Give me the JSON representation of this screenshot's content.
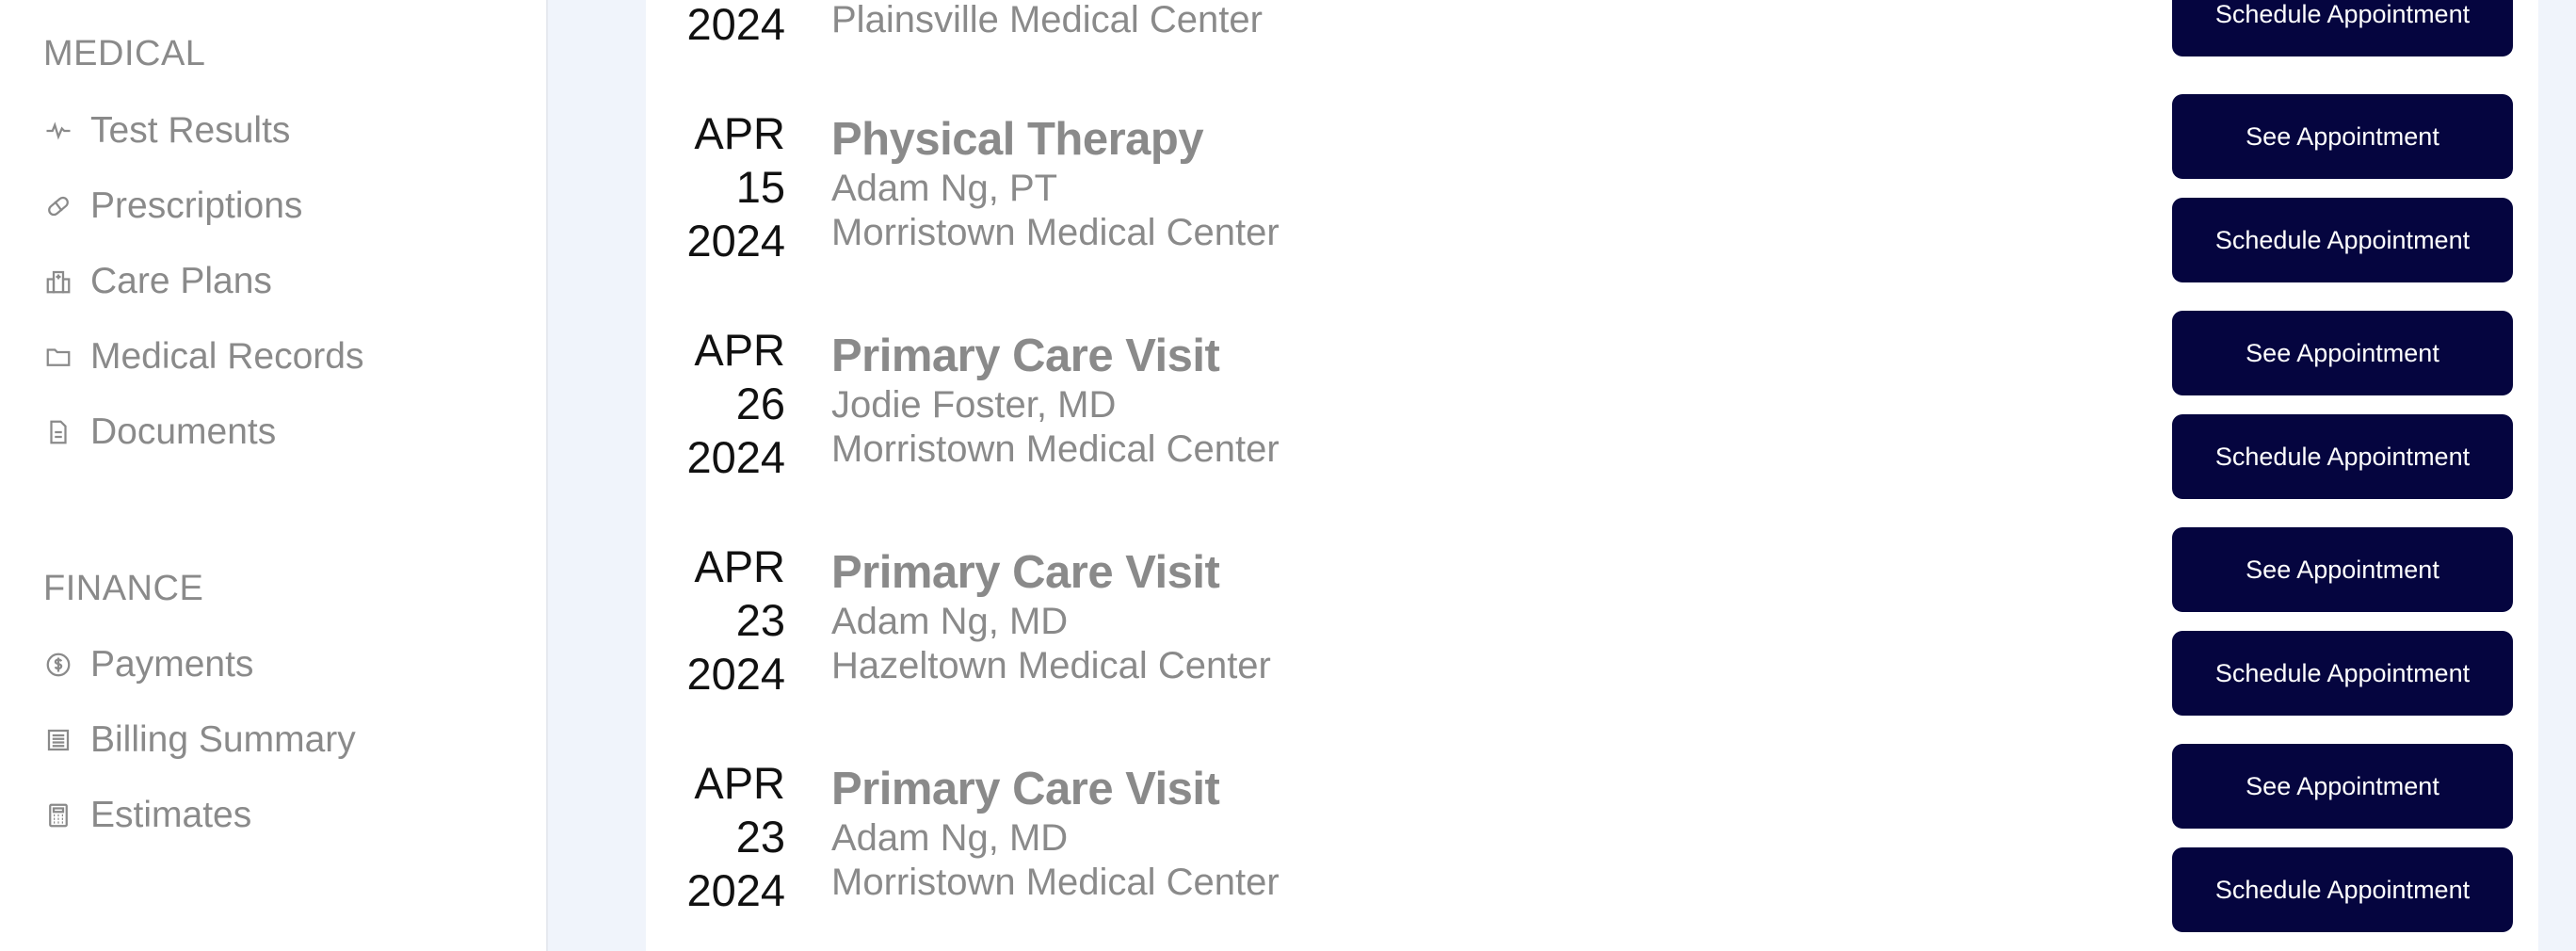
{
  "sidebar": {
    "medical": {
      "title": "MEDICAL",
      "items": [
        {
          "label": "Test Results",
          "icon": "activity-icon"
        },
        {
          "label": "Prescriptions",
          "icon": "pill-icon"
        },
        {
          "label": "Care Plans",
          "icon": "hospital-icon"
        },
        {
          "label": "Medical Records",
          "icon": "folder-icon"
        },
        {
          "label": "Documents",
          "icon": "document-icon"
        }
      ]
    },
    "finance": {
      "title": "FINANCE",
      "items": [
        {
          "label": "Payments",
          "icon": "dollar-icon"
        },
        {
          "label": "Billing Summary",
          "icon": "receipt-icon"
        },
        {
          "label": "Estimates",
          "icon": "calculator-icon"
        }
      ]
    }
  },
  "appointments": [
    {
      "year": "2024",
      "location": "Plainsville Medical Center",
      "schedule_label": "Schedule Appointment"
    },
    {
      "month": "APR",
      "day": "15",
      "year": "2024",
      "title": "Physical Therapy",
      "provider": "Adam Ng, PT",
      "location": "Morristown Medical Center",
      "see_label": "See Appointment",
      "schedule_label": "Schedule Appointment"
    },
    {
      "month": "APR",
      "day": "26",
      "year": "2024",
      "title": "Primary Care Visit",
      "provider": "Jodie Foster, MD",
      "location": "Morristown Medical Center",
      "see_label": "See Appointment",
      "schedule_label": "Schedule Appointment"
    },
    {
      "month": "APR",
      "day": "23",
      "year": "2024",
      "title": "Primary Care Visit",
      "provider": "Adam Ng, MD",
      "location": "Hazeltown Medical Center",
      "see_label": "See Appointment",
      "schedule_label": "Schedule Appointment"
    },
    {
      "month": "APR",
      "day": "23",
      "year": "2024",
      "title": "Primary Care Visit",
      "provider": "Adam Ng, MD",
      "location": "Morristown Medical Center",
      "see_label": "See Appointment",
      "schedule_label": "Schedule Appointment"
    }
  ],
  "colors": {
    "button_bg": "#05053f",
    "text_muted": "#8a8a8a",
    "page_bg": "#f0f4fb"
  }
}
